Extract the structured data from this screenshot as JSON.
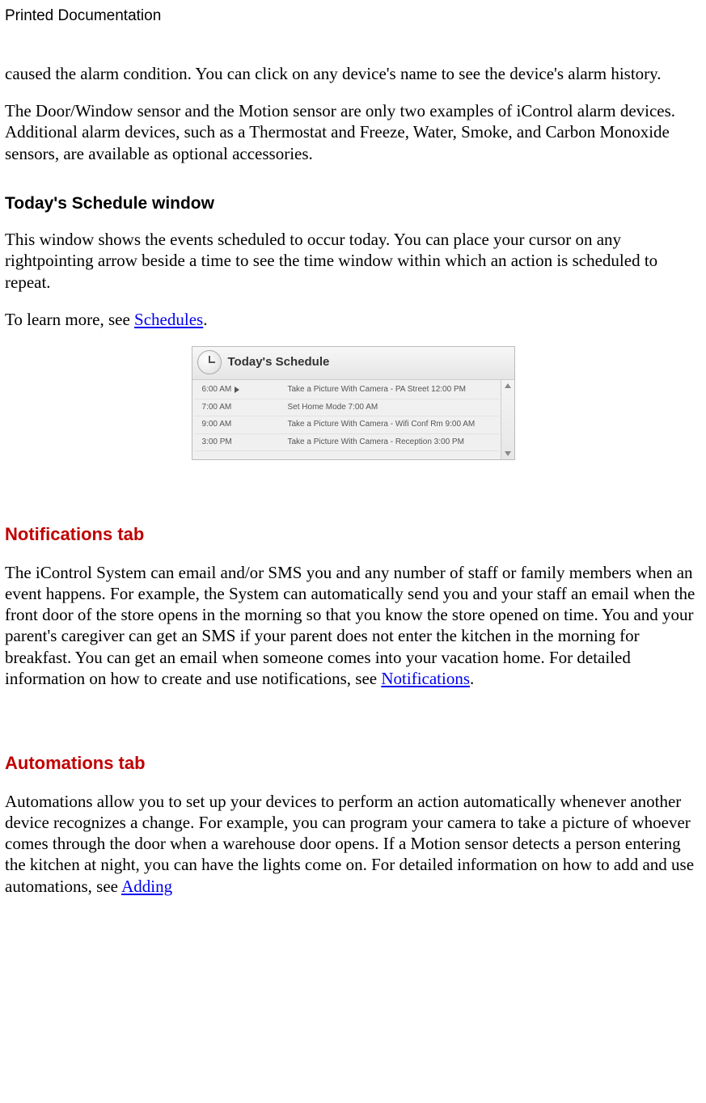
{
  "header": "Printed Documentation",
  "para1": "caused the alarm condition. You can click on any device's name to see the device's alarm history.",
  "para2": "The Door/Window sensor and the Motion sensor are only two examples of iControl alarm devices. Additional alarm devices, such as a Thermostat and Freeze, Water, Smoke, and Carbon Monoxide sensors, are available as optional accessories.",
  "heading_today": "Today's Schedule window",
  "para3": "This window shows the events scheduled to occur today. You can place your cursor on any rightpointing arrow beside a time to see the time window within which an action is scheduled to repeat.",
  "para4a": "To learn more, see ",
  "link_schedules": "Schedules",
  "para4b": ".",
  "schedule": {
    "title": "Today's Schedule",
    "rows": [
      {
        "time": "6:00 AM",
        "arrow": true,
        "desc": "Take a Picture With Camera - PA Street 12:00 PM"
      },
      {
        "time": "7:00 AM",
        "arrow": false,
        "desc": "Set Home Mode 7:00 AM"
      },
      {
        "time": "9:00 AM",
        "arrow": false,
        "desc": "Take a Picture With Camera - Wifi Conf Rm 9:00 AM"
      },
      {
        "time": "3:00 PM",
        "arrow": false,
        "desc": "Take a Picture With Camera - Reception 3:00 PM"
      },
      {
        "time": "",
        "arrow": false,
        "desc": ""
      }
    ]
  },
  "heading_notif": "Notifications tab",
  "para5a": "The iControl System can email and/or SMS you and any number of staff or family members when an event happens. For example, the System can automatically send you and your staff an email when the front door of the store opens in the morning so that you know the store opened on time. You and your parent's caregiver can get an SMS if your parent does not enter the kitchen in the morning for breakfast. You can get an email when someone comes into your vacation home. For detailed information on how to create and use notifications, see ",
  "link_notifications": "Notifications",
  "para5b": ".",
  "heading_auto": "Automations tab",
  "para6a": "Automations allow you to set up your devices to perform an action automatically whenever another device recognizes a change. For example, you can program your camera to take a picture of whoever comes through the door when a warehouse door opens. If a Motion sensor detects a person entering the kitchen at night, you can have the lights come on. For detailed information on how to add and use automations, see ",
  "link_adding": "Adding"
}
